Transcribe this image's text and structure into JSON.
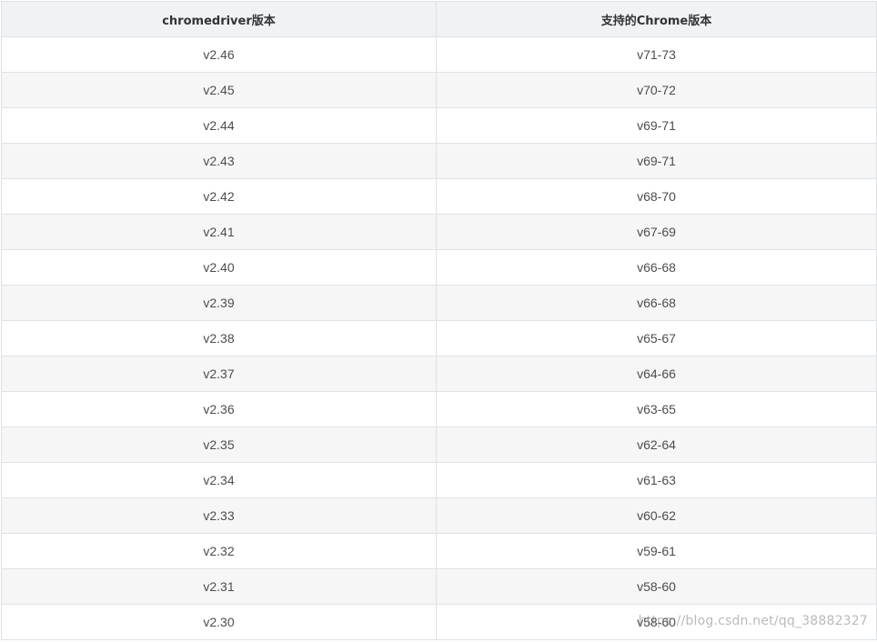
{
  "table": {
    "headers": [
      "chromedriver版本",
      "支持的Chrome版本"
    ],
    "rows": [
      [
        "v2.46",
        "v71-73"
      ],
      [
        "v2.45",
        "v70-72"
      ],
      [
        "v2.44",
        "v69-71"
      ],
      [
        "v2.43",
        "v69-71"
      ],
      [
        "v2.42",
        "v68-70"
      ],
      [
        "v2.41",
        "v67-69"
      ],
      [
        "v2.40",
        "v66-68"
      ],
      [
        "v2.39",
        "v66-68"
      ],
      [
        "v2.38",
        "v65-67"
      ],
      [
        "v2.37",
        "v64-66"
      ],
      [
        "v2.36",
        "v63-65"
      ],
      [
        "v2.35",
        "v62-64"
      ],
      [
        "v2.34",
        "v61-63"
      ],
      [
        "v2.33",
        "v60-62"
      ],
      [
        "v2.32",
        "v59-61"
      ],
      [
        "v2.31",
        "v58-60"
      ],
      [
        "v2.30",
        "v58-60"
      ]
    ]
  },
  "watermark": "https://blog.csdn.net/qq_38882327"
}
